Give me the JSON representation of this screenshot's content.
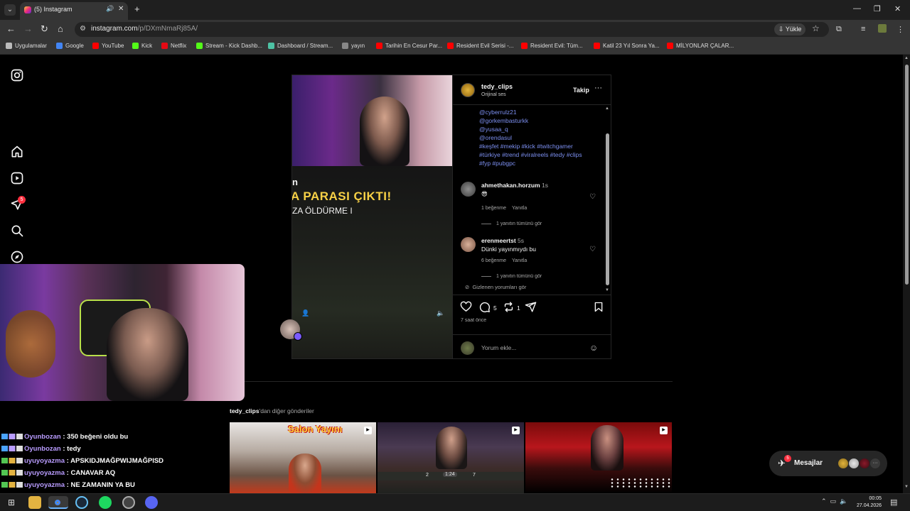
{
  "browser": {
    "tab_title": "(5) Instagram",
    "new_tab": "+",
    "url_host": "instagram.com",
    "url_path": "/p/DXmNmaRj85A/",
    "yukle_label": "Yükle"
  },
  "bookmarks": [
    {
      "label": "Uygulamalar",
      "color": "#bbbbbb"
    },
    {
      "label": "Google",
      "color": "#4285f4"
    },
    {
      "label": "YouTube",
      "color": "#ff0000"
    },
    {
      "label": "Kick",
      "color": "#53fc18"
    },
    {
      "label": "Netflix",
      "color": "#e50914"
    },
    {
      "label": "Stream - Kick Dashb...",
      "color": "#53fc18"
    },
    {
      "label": "Dashboard / Stream...",
      "color": "#4ec3a5"
    },
    {
      "label": "yayın",
      "color": "#888888"
    },
    {
      "label": "Tarihin En Cesur Par...",
      "color": "#ff0000"
    },
    {
      "label": "Resident Evil Serisi -...",
      "color": "#ff0000"
    },
    {
      "label": "Resident Evil: Tüm...",
      "color": "#ff0000"
    },
    {
      "label": "Katil 23 Yıl Sonra Ya...",
      "color": "#ff0000"
    },
    {
      "label": "MİLYONLAR ÇALAR...",
      "color": "#ff0000"
    }
  ],
  "sidebar": {
    "notifications_badge": "5"
  },
  "post": {
    "media_text_1": "n",
    "media_text_2": "A PARASI ÇIKTI!",
    "media_text_3": "ZA   ÖLDÜRME I",
    "username": "tedy_clips",
    "audio": "Orijinal ses",
    "follow_label": "Takip",
    "caption_lines": [
      "@cyberrulz21",
      "@gorkembasturkk",
      "@yusaa_q",
      "@orendasul",
      "#keşfet #mekip #kick #twitchgamer",
      "#türkiye #trend #viralreels #tedy #clips",
      "#fyp #pubgpc"
    ],
    "comments": [
      {
        "user": "ahmethakan.horzum",
        "time": "1s",
        "text": "😎",
        "likes": "1 beğenme",
        "reply": "Yanıtla",
        "replies": "1 yanıtın tümünü gör"
      },
      {
        "user": "erenmeertst",
        "time": "5s",
        "text": "Dünki yayınmıydı bu",
        "likes": "6 beğenme",
        "reply": "Yanıtla",
        "replies": "1 yanıtın tümünü gör"
      }
    ],
    "hidden_comments": "Gizlenen yorumları gör",
    "comment_count": "5",
    "repost_count": "1",
    "time_ago": "7 saat önce",
    "add_comment_placeholder": "Yorum ekle..."
  },
  "more_posts": {
    "user": "tedy_clips",
    "suffix": "'dan diğer gönderiler",
    "thumb1_text": "Salon Yayını",
    "thumb2_score_left": "2",
    "thumb2_time": "1:24",
    "thumb2_score_right": "7"
  },
  "messages": {
    "label": "Mesajlar",
    "badge": "5"
  },
  "chat": [
    {
      "user": "Oyunbozan",
      "message": ": 350 beğeni oldu bu"
    },
    {
      "user": "Oyunbozan",
      "message": ": tedy"
    },
    {
      "user": "uyuyoyazma",
      "message": ": APSKIDJMAĞPWIJMAĞPISD"
    },
    {
      "user": "uyuyoyazma",
      "message": ": CANAVAR AQ"
    },
    {
      "user": "uyuyoyazma",
      "message": ": NE ZAMANIN YA BU"
    }
  ],
  "taskbar": {
    "time": "00:05",
    "date": "27.04.2026"
  }
}
